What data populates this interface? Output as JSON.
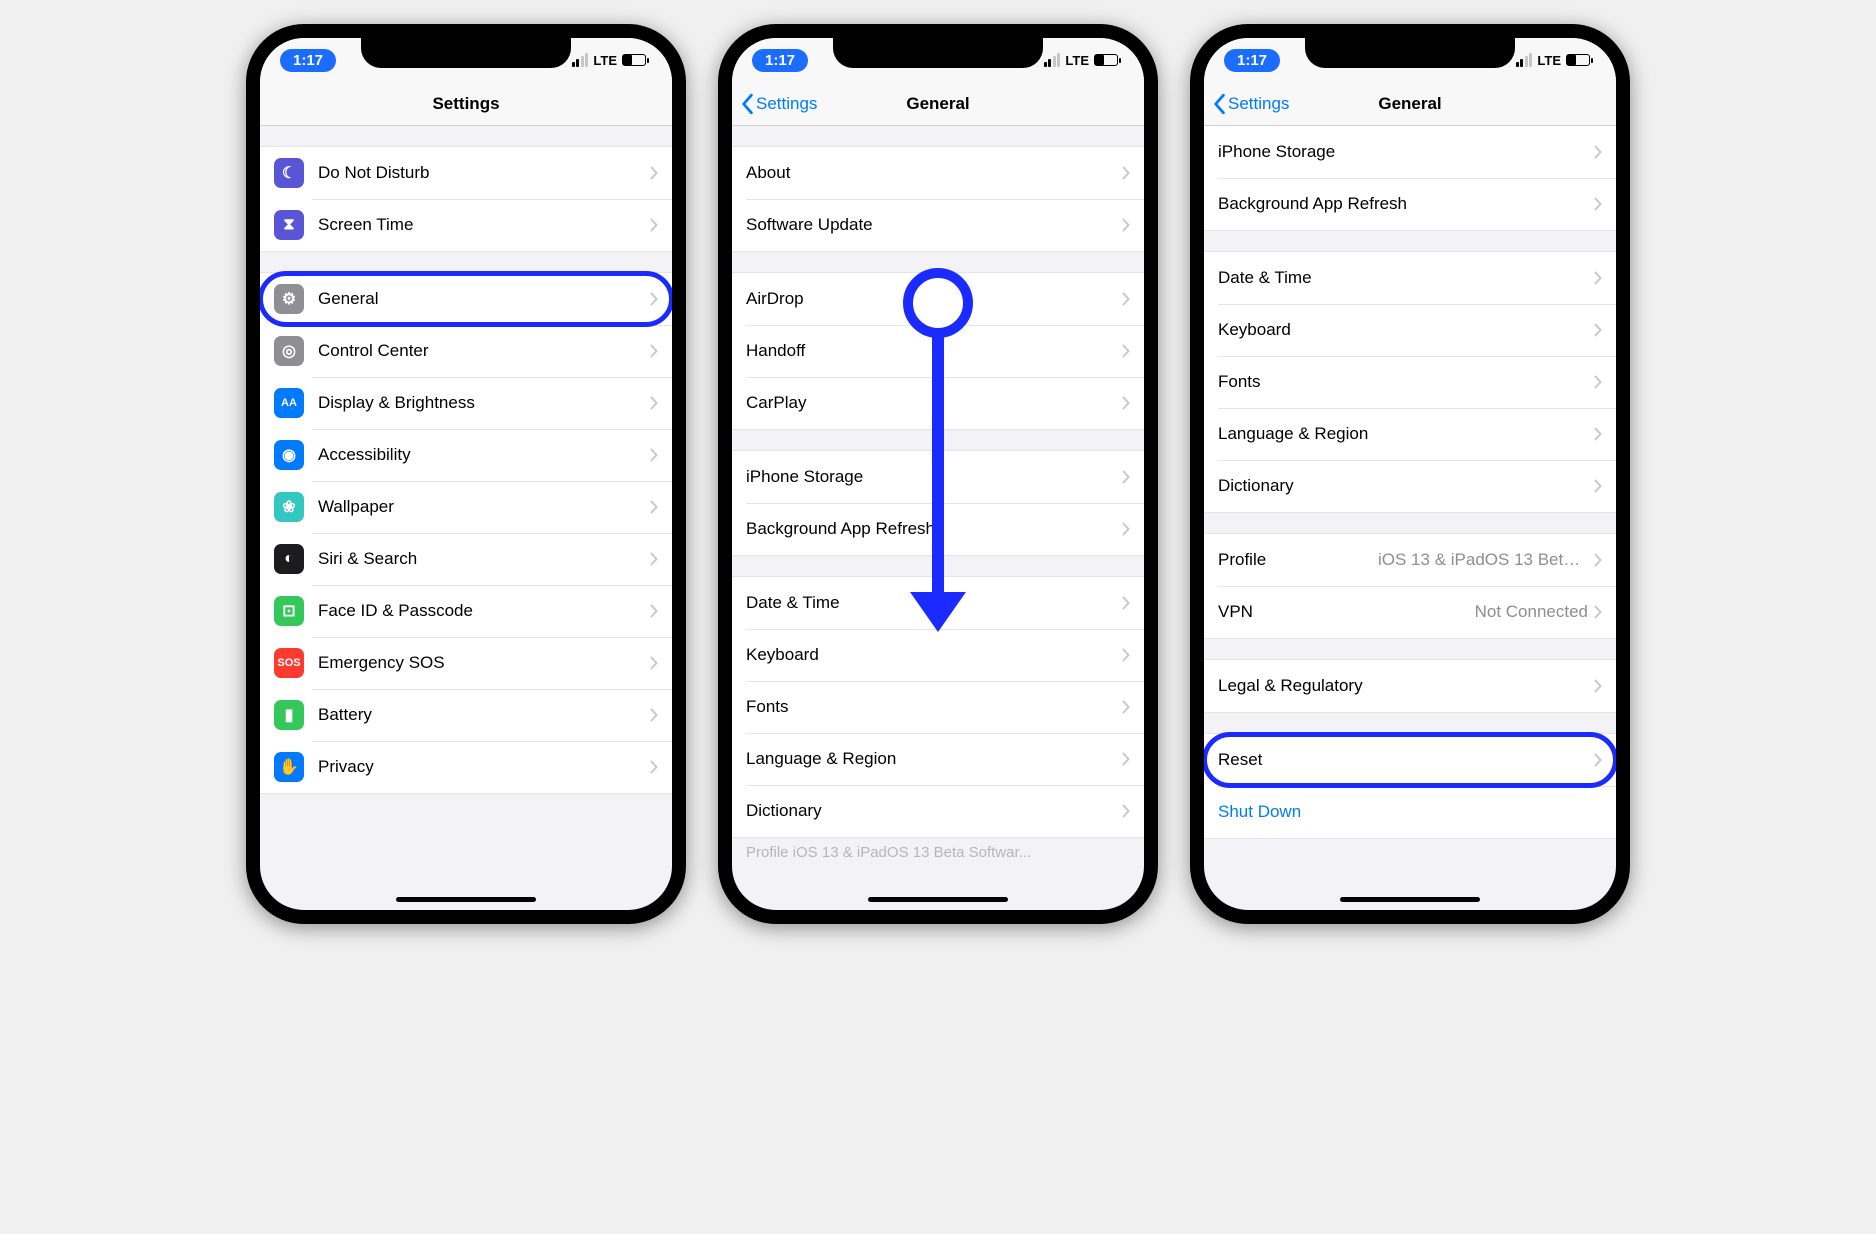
{
  "status": {
    "time": "1:17",
    "network_label": "LTE"
  },
  "screen1": {
    "title": "Settings",
    "groups": [
      {
        "items": [
          {
            "icon": "moon-icon",
            "color": "#5856d6",
            "label": "Do Not Disturb"
          },
          {
            "icon": "hourglass-icon",
            "color": "#5856d6",
            "label": "Screen Time"
          }
        ]
      },
      {
        "items": [
          {
            "icon": "gear-icon",
            "color": "#8e8e93",
            "label": "General",
            "highlight": true
          },
          {
            "icon": "toggles-icon",
            "color": "#8e8e93",
            "label": "Control Center"
          },
          {
            "icon": "aa-icon",
            "color": "#007aff",
            "label": "Display & Brightness"
          },
          {
            "icon": "accessibility-icon",
            "color": "#007aff",
            "label": "Accessibility"
          },
          {
            "icon": "flower-icon",
            "color": "#34c7c2",
            "label": "Wallpaper"
          },
          {
            "icon": "siri-icon",
            "color": "#1c1c1e",
            "label": "Siri & Search"
          },
          {
            "icon": "faceid-icon",
            "color": "#34c759",
            "label": "Face ID & Passcode"
          },
          {
            "icon": "sos-icon",
            "color": "#ff3b30",
            "label": "Emergency SOS"
          },
          {
            "icon": "battery-icon",
            "color": "#34c759",
            "label": "Battery"
          },
          {
            "icon": "hand-icon",
            "color": "#007aff",
            "label": "Privacy"
          }
        ]
      }
    ]
  },
  "screen2": {
    "back": "Settings",
    "title": "General",
    "groups": [
      {
        "items": [
          {
            "label": "About"
          },
          {
            "label": "Software Update"
          }
        ]
      },
      {
        "items": [
          {
            "label": "AirDrop"
          },
          {
            "label": "Handoff"
          },
          {
            "label": "CarPlay"
          }
        ]
      },
      {
        "items": [
          {
            "label": "iPhone Storage"
          },
          {
            "label": "Background App Refresh"
          }
        ]
      },
      {
        "items": [
          {
            "label": "Date & Time"
          },
          {
            "label": "Keyboard"
          },
          {
            "label": "Fonts"
          },
          {
            "label": "Language & Region"
          },
          {
            "label": "Dictionary"
          }
        ]
      }
    ],
    "partial": "Profile   iOS 13 & iPadOS 13 Beta Softwar..."
  },
  "screen3": {
    "back": "Settings",
    "title": "General",
    "groups_top_partial": [
      {
        "label": "iPhone Storage"
      },
      {
        "label": "Background App Refresh"
      }
    ],
    "groups": [
      {
        "items": [
          {
            "label": "Date & Time"
          },
          {
            "label": "Keyboard"
          },
          {
            "label": "Fonts"
          },
          {
            "label": "Language & Region"
          },
          {
            "label": "Dictionary"
          }
        ]
      },
      {
        "items": [
          {
            "label": "Profile",
            "detail": "iOS 13 & iPadOS 13 Beta Softwar..."
          },
          {
            "label": "VPN",
            "detail": "Not Connected"
          }
        ]
      },
      {
        "items": [
          {
            "label": "Legal & Regulatory"
          }
        ]
      },
      {
        "items": [
          {
            "label": "Reset",
            "highlight": true
          },
          {
            "label": "Shut Down",
            "link": true,
            "no_chev": true
          }
        ]
      }
    ]
  }
}
